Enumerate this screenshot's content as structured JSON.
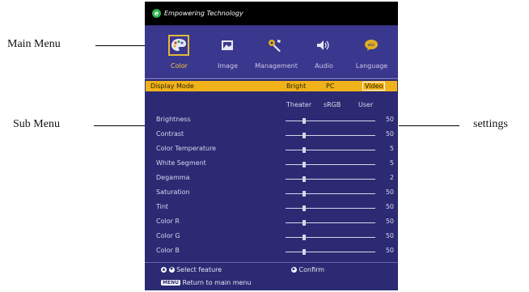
{
  "callouts": {
    "main_menu": "Main Menu",
    "sub_menu": "Sub Menu",
    "settings": "settings"
  },
  "osd": {
    "brand": "Empowering Technology",
    "main_menu": [
      {
        "label": "Color",
        "icon": "palette-icon",
        "active": true
      },
      {
        "label": "Image",
        "icon": "picture-icon",
        "active": false
      },
      {
        "label": "Management",
        "icon": "tools-icon",
        "active": false
      },
      {
        "label": "Audio",
        "icon": "speaker-icon",
        "active": false
      },
      {
        "label": "Language",
        "icon": "language-icon",
        "active": false
      }
    ],
    "display_mode": {
      "label": "Display Mode",
      "options_row1": [
        "Bright",
        "PC",
        "Video"
      ],
      "selected": "Video",
      "options_row2": [
        "Theater",
        "sRGB",
        "User"
      ]
    },
    "settings": [
      {
        "label": "Brightness",
        "value": "50"
      },
      {
        "label": "Contrast",
        "value": "50"
      },
      {
        "label": "Color Temperature",
        "value": "5"
      },
      {
        "label": "White Segment",
        "value": "5"
      },
      {
        "label": "Degamma",
        "value": "2"
      },
      {
        "label": "Saturation",
        "value": "50"
      },
      {
        "label": "Tint",
        "value": "50"
      },
      {
        "label": "Color R",
        "value": "50"
      },
      {
        "label": "Color G",
        "value": "50"
      },
      {
        "label": "Color B",
        "value": "50"
      }
    ],
    "footer": {
      "select": "Select feature",
      "confirm": "Confirm",
      "menu_key": "MENU",
      "return": "Return to main menu"
    }
  },
  "colors": {
    "panel": "#2b2a73",
    "highlight": "#f0b21a",
    "active_border": "#e1b93a"
  }
}
